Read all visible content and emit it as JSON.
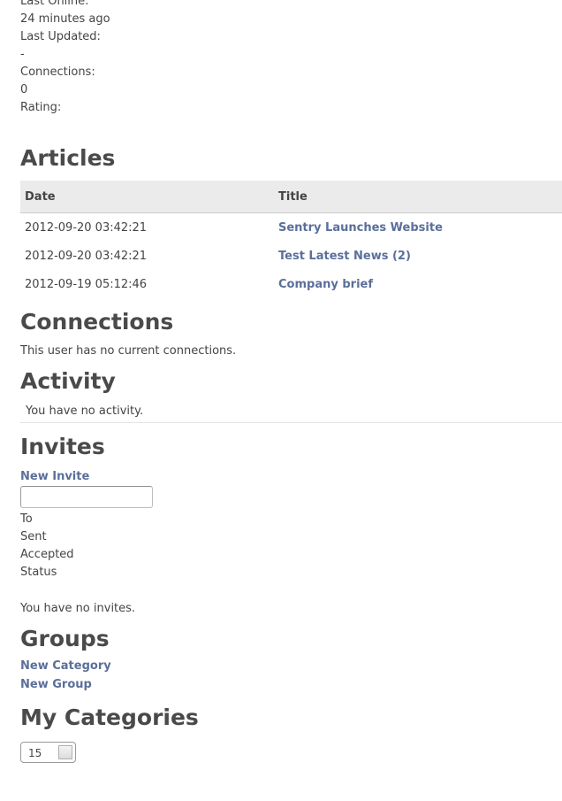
{
  "profile": {
    "last_online_label": "Last Online:",
    "last_online_value": "24 minutes ago",
    "last_updated_label": "Last Updated:",
    "last_updated_value": "-",
    "connections_label": "Connections:",
    "connections_value": "0",
    "rating_label": "Rating:"
  },
  "articles": {
    "heading": "Articles",
    "columns": [
      "Date",
      "Title"
    ],
    "rows": [
      {
        "date": "2012-09-20 03:42:21",
        "title": "Sentry Launches Website"
      },
      {
        "date": "2012-09-20 03:42:21",
        "title": "Test Latest News (2)"
      },
      {
        "date": "2012-09-19 05:12:46",
        "title": "Company brief"
      }
    ]
  },
  "connections": {
    "heading": "Connections",
    "message": "This user has no current connections."
  },
  "activity": {
    "heading": "Activity",
    "message": "You have no activity."
  },
  "invites": {
    "heading": "Invites",
    "new_invite_link": "New Invite",
    "input_value": "",
    "columns": [
      "To",
      "Sent",
      "Accepted",
      "Status"
    ],
    "message": "You have no invites."
  },
  "groups": {
    "heading": "Groups",
    "new_category_link": "New Category",
    "new_group_link": "New Group"
  },
  "my_categories": {
    "heading": "My Categories",
    "per_page_value": "15"
  },
  "colors": {
    "link": "#5a6f9a",
    "heading": "#4a4a4a",
    "text": "#444444",
    "table_header_bg": "#ebebeb"
  }
}
